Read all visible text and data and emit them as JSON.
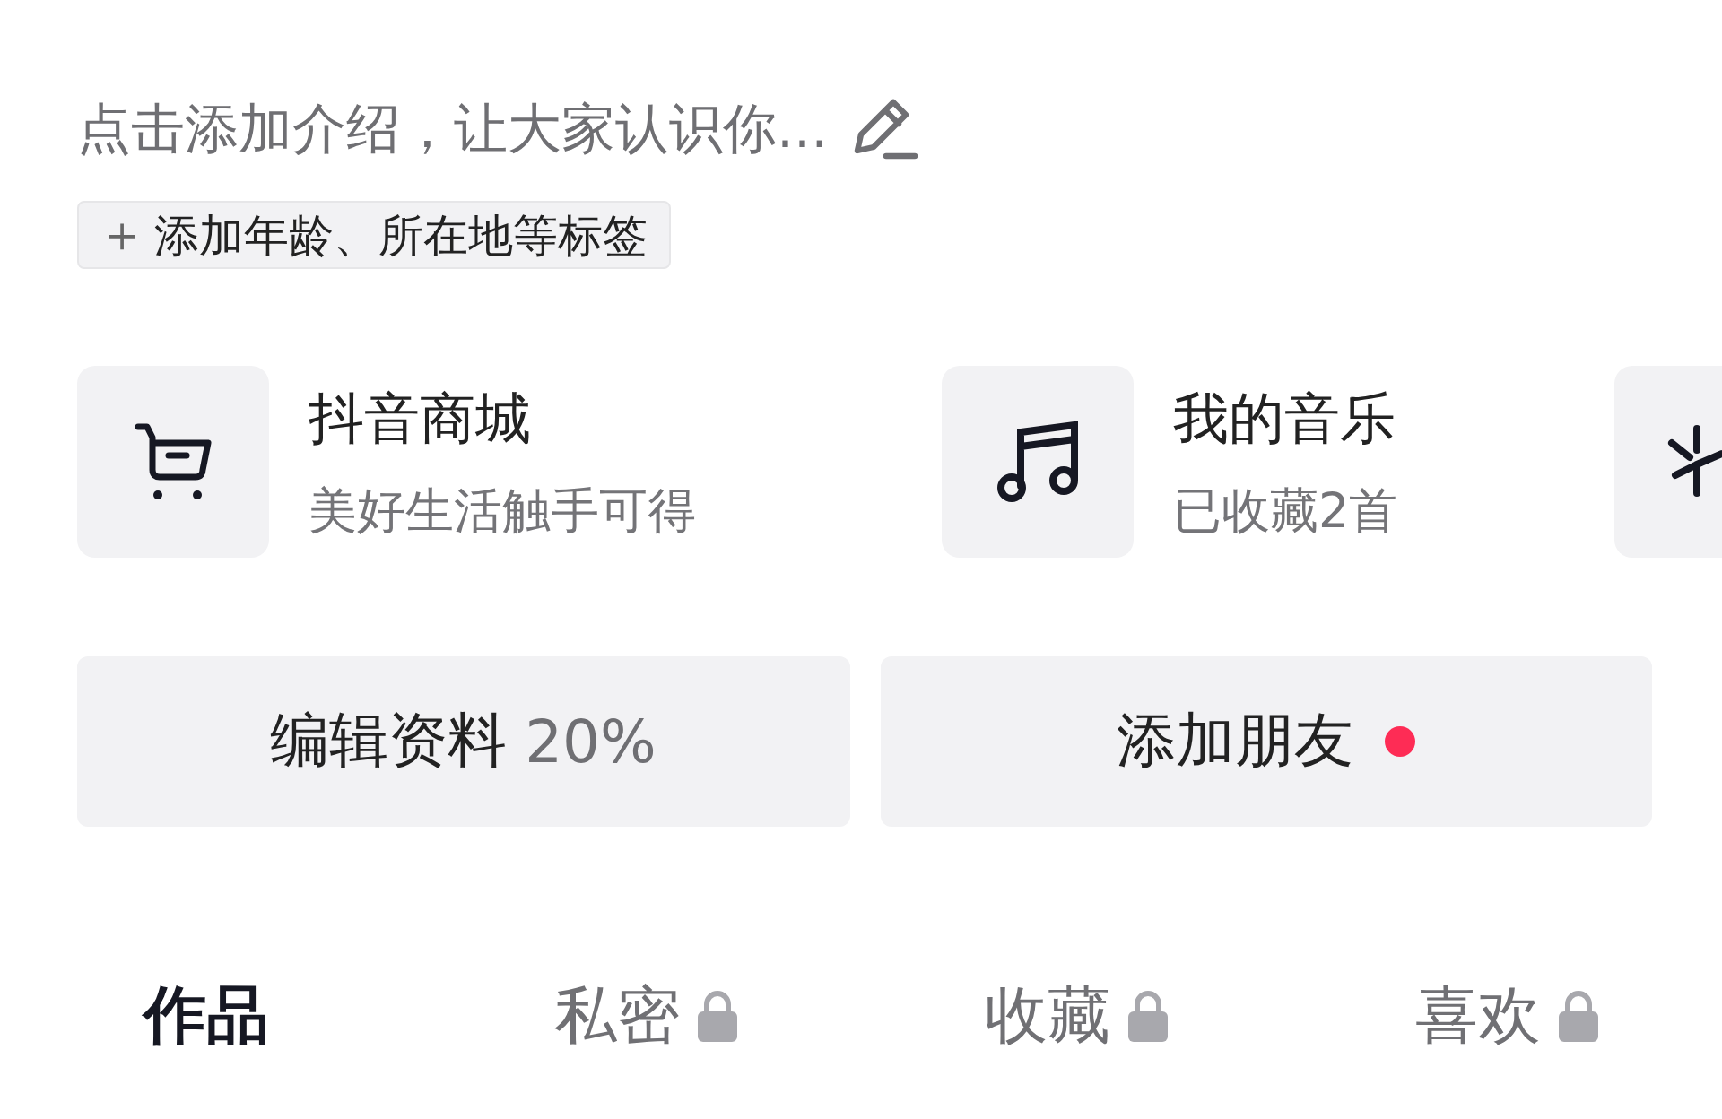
{
  "bio": {
    "placeholder": "点击添加介绍，让大家认识你..."
  },
  "tag_chip": {
    "icon": "＋",
    "label": "添加年龄、所在地等标签"
  },
  "shortcuts": [
    {
      "kind": "cart",
      "title": "抖音商城",
      "subtitle": "美好生活触手可得"
    },
    {
      "kind": "music",
      "title": "我的音乐",
      "subtitle": "已收藏2首"
    },
    {
      "kind": "more"
    }
  ],
  "actions": [
    {
      "label": "编辑资料",
      "extra": "20%",
      "notification": false
    },
    {
      "label": "添加朋友",
      "notification": true
    }
  ],
  "tabs": [
    {
      "label": "作品",
      "selected": true,
      "locked": false
    },
    {
      "label": "私密",
      "selected": false,
      "locked": true
    },
    {
      "label": "收藏",
      "selected": false,
      "locked": true
    },
    {
      "label": "喜欢",
      "selected": false,
      "locked": true
    }
  ]
}
